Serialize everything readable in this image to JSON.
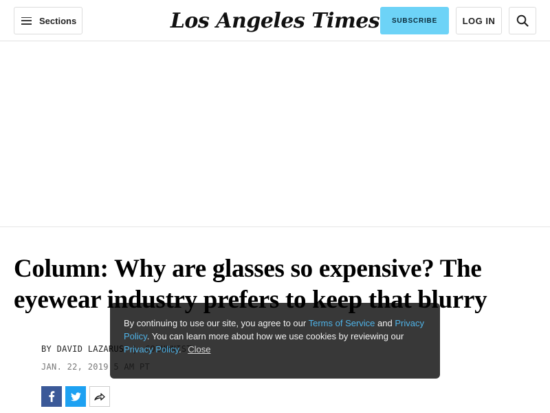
{
  "header": {
    "sections_label": "Sections",
    "logo_text": "Los Angeles Times",
    "subscribe_label": "SUBSCRIBE",
    "login_label": "LOG IN",
    "icons": {
      "menu": "hamburger-icon",
      "search": "search-icon"
    }
  },
  "article": {
    "headline": "Column: Why are glasses so expensive? The eyewear industry prefers to keep that blurry",
    "byline_prefix": "BY",
    "author": "DAVID LAZARUS",
    "separator": "|",
    "role": "COLUMNIST",
    "date": "JAN. 22, 2019 5 AM PT"
  },
  "share": {
    "facebook_icon": "facebook-icon",
    "twitter_icon": "twitter-icon",
    "more_icon": "share-arrow-icon"
  },
  "cookie_banner": {
    "text_1": "By continuing to use our site, you agree to our ",
    "terms_link": "Terms of Service",
    "text_2": " and ",
    "privacy_link_1": "Privacy Policy",
    "text_3": ". You can learn more about how we use cookies by reviewing our ",
    "privacy_link_2": "Privacy Policy",
    "text_4": ".",
    "close_label": "Close"
  },
  "colors": {
    "subscribe_bg": "#6dd3f7",
    "facebook": "#3b5998",
    "twitter": "#1da1f2",
    "link": "#4fb3e8"
  }
}
